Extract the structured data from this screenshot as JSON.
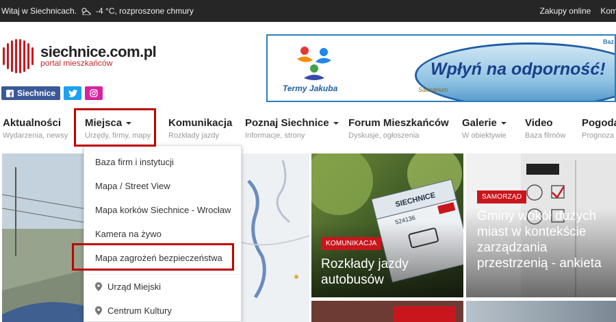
{
  "topbar": {
    "greeting": "Witaj w Siechnicach.",
    "weather_icon": "cloud-sun-icon",
    "weather": "-4 °C, rozproszone chmury",
    "links": [
      "Zakupy online",
      "Kom"
    ]
  },
  "logo": {
    "title": "siechnice.com.pl",
    "subtitle": "portal mieszkańców"
  },
  "social": {
    "facebook": "Siechnice"
  },
  "banner": {
    "brand": "Termy Jakuba",
    "slogan": "Wpłyń na odporność!",
    "small": "Saunarium",
    "corner": "Baz"
  },
  "nav": [
    {
      "label": "Aktualności",
      "sub": "Wydarzenia, newsy"
    },
    {
      "label": "Miejsca",
      "sub": "Urzędy, firmy, mapy"
    },
    {
      "label": "Komunikacja",
      "sub": "Rozkłady jazdy"
    },
    {
      "label": "Poznaj Siechnice",
      "sub": "Informacje, strony"
    },
    {
      "label": "Forum Mieszkańców",
      "sub": "Dyskusje, ogłoszenia"
    },
    {
      "label": "Galerie",
      "sub": "W obiektywie"
    },
    {
      "label": "Video",
      "sub": "Baza filmów"
    },
    {
      "label": "Pogoda",
      "sub": "Prognoza"
    }
  ],
  "dropdown": [
    "Baza firm i instytucji",
    "Mapa / Street View",
    "Mapa korków Siechnice - Wrocław",
    "Kamera na żywo",
    "Mapa zagrożeń bezpieczeństwa",
    "Urząd Miejski",
    "Centrum Kultury"
  ],
  "tiles": {
    "mid": {
      "badge": "KOMUNIKACJA",
      "title": "Rozkłady jazdy autobusów",
      "sign": "SIECHNICE",
      "sign_num": "524136"
    },
    "right": {
      "badge": "SAMORZĄD",
      "title": "Gminy wokół dużych miast w kontekście zarządzania przestrzenią - ankieta"
    }
  },
  "colors": {
    "accent": "#c9161d",
    "topbar": "#262626",
    "highlight": "#c00000"
  }
}
